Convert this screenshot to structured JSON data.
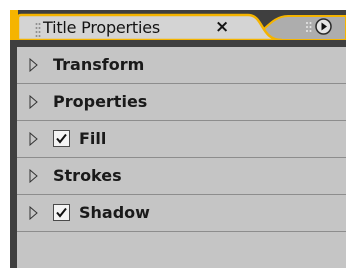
{
  "panel": {
    "tab_title": "Title Properties",
    "close_glyph": "×",
    "menu_icon": "flyout-menu-icon",
    "accent_color": "#f5b400",
    "sections": [
      {
        "label": "Transform",
        "has_checkbox": false
      },
      {
        "label": "Properties",
        "has_checkbox": false
      },
      {
        "label": "Fill",
        "has_checkbox": true,
        "checked": true
      },
      {
        "label": "Strokes",
        "has_checkbox": false
      },
      {
        "label": "Shadow",
        "has_checkbox": true,
        "checked": true
      }
    ]
  }
}
